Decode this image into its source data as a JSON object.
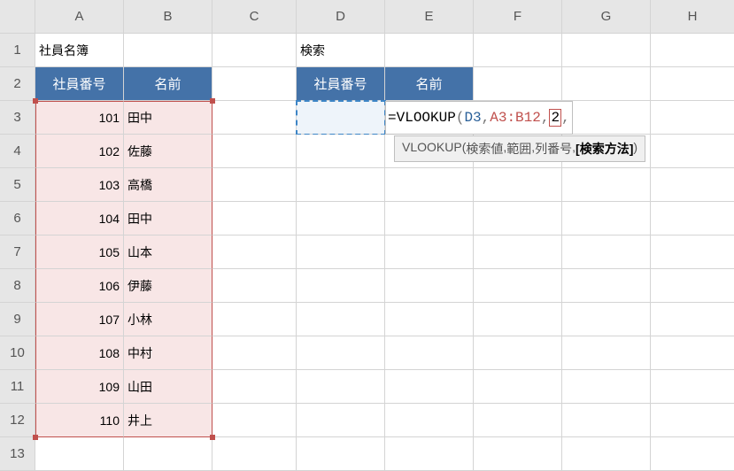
{
  "columns": [
    "A",
    "B",
    "C",
    "D",
    "E",
    "F",
    "G",
    "H"
  ],
  "rows": [
    "1",
    "2",
    "3",
    "4",
    "5",
    "6",
    "7",
    "8",
    "9",
    "10",
    "11",
    "12",
    "13"
  ],
  "labels": {
    "roster_title": "社員名簿",
    "search_title": "検索",
    "emp_no": "社員番号",
    "name": "名前"
  },
  "roster": [
    {
      "no": "101",
      "name": "田中"
    },
    {
      "no": "102",
      "name": "佐藤"
    },
    {
      "no": "103",
      "name": "高橋"
    },
    {
      "no": "104",
      "name": "田中"
    },
    {
      "no": "105",
      "name": "山本"
    },
    {
      "no": "106",
      "name": "伊藤"
    },
    {
      "no": "107",
      "name": "小林"
    },
    {
      "no": "108",
      "name": "中村"
    },
    {
      "no": "109",
      "name": "山田"
    },
    {
      "no": "110",
      "name": "井上"
    }
  ],
  "formula": {
    "eq": "=",
    "fn": "VLOOKUP",
    "open": "(",
    "a1": "D3",
    "c1": ",",
    "a2": "A3:B12",
    "c2": ",",
    "a3": "2",
    "c3": ","
  },
  "tooltip": {
    "fn": "VLOOKUP(",
    "p1": "検索値",
    "s": ", ",
    "p2": "範囲",
    "p3": "列番号",
    "p4": "[検索方法]",
    "close": ")"
  }
}
